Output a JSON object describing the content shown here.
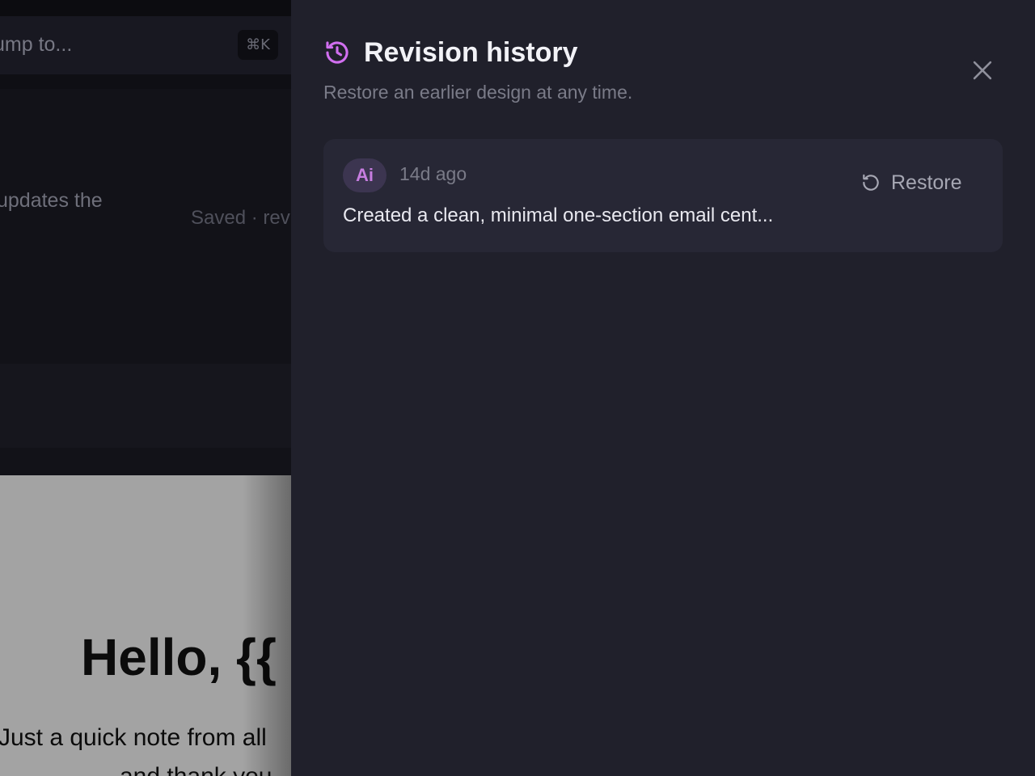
{
  "background": {
    "search_placeholder": "ump to...",
    "shortcut": "⌘K",
    "editor_text": "updates the",
    "status_text": "Saved · rev",
    "email_heading": "Hello, {{",
    "email_line1": "Just a quick note from all",
    "email_line2": "and thank you"
  },
  "drawer": {
    "title": "Revision history",
    "subtitle": "Restore an earlier design at any time.",
    "accent_color": "#d16ff0",
    "icons": {
      "header": "history-icon",
      "close": "close-icon",
      "restore": "restore-icon"
    },
    "revisions": [
      {
        "author_badge": "Ai",
        "time": "14d ago",
        "description": "Created a clean, minimal one-section email cent...",
        "action_label": "Restore"
      }
    ]
  }
}
